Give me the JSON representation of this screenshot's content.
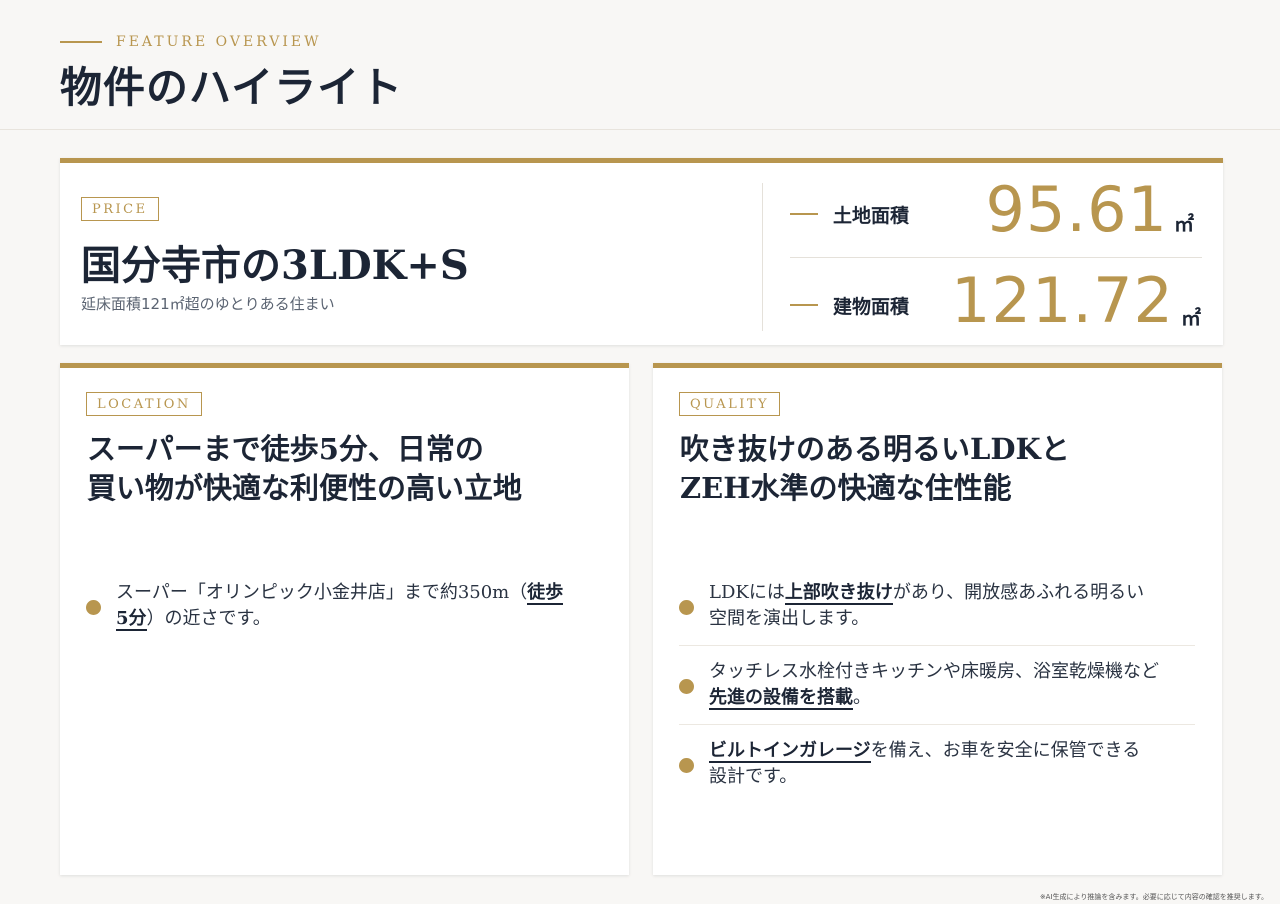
{
  "header": {
    "eyebrow": "FEATURE OVERVIEW",
    "title": "物件のハイライト"
  },
  "price": {
    "tag": "PRICE",
    "headline": "国分寺市の3LDK+S",
    "sub": "延床面積121㎡超のゆとりある住まい",
    "stats": [
      {
        "label": "土地面積",
        "value": "95.61",
        "unit": "㎡"
      },
      {
        "label": "建物面積",
        "value": "121.72",
        "unit": "㎡"
      }
    ]
  },
  "location": {
    "tag": "LOCATION",
    "heading": [
      "スーパーまで徒歩5分、日常の",
      "買い物が快適な利便性の高い立地"
    ],
    "bullets": [
      {
        "line1_pre": "スーパー「オリンピック小金井店」まで約350m（",
        "line1_hl": "徒歩",
        "line2_hl": "5分",
        "line2_post": "）の近さです。"
      }
    ]
  },
  "quality": {
    "tag": "QUALITY",
    "heading": [
      "吹き抜けのある明るいLDKと",
      "ZEH水準の快適な住性能"
    ],
    "bullets": [
      {
        "line1_pre": "LDKには",
        "line1_hl": "上部吹き抜け",
        "line1_post": "があり、開放感あふれる明るい",
        "line2": "空間を演出します。"
      },
      {
        "line1": "タッチレス水栓付きキッチンや床暖房、浴室乾燥機など",
        "line2_hl": "先進の設備を搭載",
        "line2_post": "。"
      },
      {
        "line1_hl": "ビルトインガレージ",
        "line1_post": "を備え、お車を安全に保管できる",
        "line2": "設計です。"
      }
    ]
  },
  "footnote": "※AI生成により推論を含みます。必要に応じて内容の確認を推奨します。",
  "colors": {
    "accent": "#b8964f",
    "ink": "#1c2535",
    "background": "#f8f7f5"
  }
}
